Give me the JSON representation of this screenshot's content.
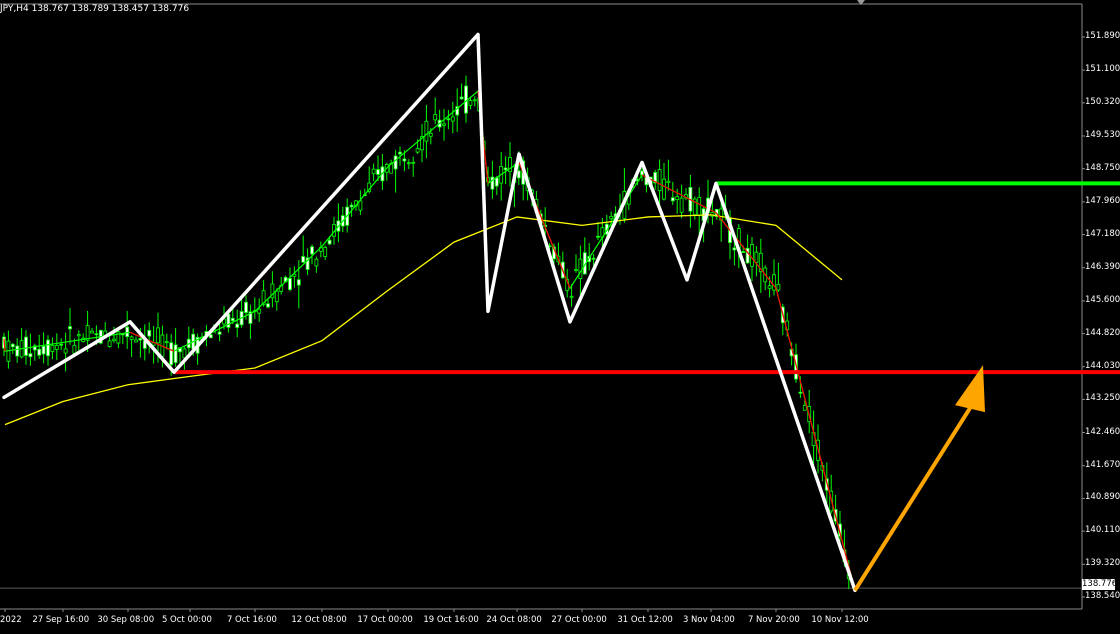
{
  "header": {
    "symbol_info": "JPY,H4 138.767 138.789 138.457 138.776"
  },
  "price_box": {
    "label": "138.776"
  },
  "colors": {
    "background": "#000000",
    "candles": "#00ff00",
    "fast_ma": "#00ff00",
    "fast_ma_down": "#ff0000",
    "slow_ma": "#ffff00",
    "zigzag": "#ffffff",
    "support_line": "#ff0000",
    "resistance_line": "#00ff00",
    "projection_arrow": "#ffa500"
  },
  "chart_data": {
    "type": "line",
    "title": "JPY,H4",
    "y_axis_ticks": [
      "151.890",
      "151.100",
      "150.320",
      "149.530",
      "148.750",
      "147.960",
      "147.180",
      "146.390",
      "145.600",
      "144.820",
      "144.030",
      "143.250",
      "142.460",
      "141.670",
      "140.890",
      "140.110",
      "139.320",
      "138.540"
    ],
    "x_axis_ticks": [
      "2022",
      "27 Sep 16:00",
      "30 Sep 08:00",
      "5 Oct 00:00",
      "7 Oct 16:00",
      "12 Oct 08:00",
      "17 Oct 00:00",
      "19 Oct 16:00",
      "24 Oct 08:00",
      "27 Oct 00:00",
      "31 Oct 12:00",
      "3 Nov 04:00",
      "7 Nov 20:00",
      "10 Nov 12:00"
    ],
    "ylim": [
      138.35,
      152.1
    ],
    "last_price": 138.776,
    "support_level": 143.9,
    "resistance_level": 148.4,
    "zigzag": [
      {
        "x": "27 Sep 16:00",
        "y": 143.3
      },
      {
        "x": "30 Sep 08:00",
        "y": 145.1
      },
      {
        "x": "5 Oct 00:00",
        "y": 143.9
      },
      {
        "x": "19 Oct 16:00",
        "y": 151.95
      },
      {
        "x": "24 Oct 00:00",
        "y": 145.35
      },
      {
        "x": "24 Oct 08:00",
        "y": 149.1
      },
      {
        "x": "27 Oct 00:00",
        "y": 145.1
      },
      {
        "x": "31 Oct 12:00",
        "y": 148.9
      },
      {
        "x": "3 Nov 00:00",
        "y": 146.1
      },
      {
        "x": "3 Nov 04:00",
        "y": 148.4
      },
      {
        "x": "10 Nov 12:00",
        "y": 138.7
      }
    ],
    "projection_arrow": {
      "from": {
        "x": "10 Nov 12:00",
        "y": 138.7
      },
      "to": {
        "y": 143.9
      }
    },
    "slow_ma": [
      {
        "x": "2022",
        "y": 142.65
      },
      {
        "x": "27 Sep 16:00",
        "y": 143.2
      },
      {
        "x": "30 Sep 08:00",
        "y": 143.6
      },
      {
        "x": "5 Oct 00:00",
        "y": 143.8
      },
      {
        "x": "7 Oct 16:00",
        "y": 144.0
      },
      {
        "x": "12 Oct 08:00",
        "y": 144.65
      },
      {
        "x": "17 Oct 00:00",
        "y": 145.85
      },
      {
        "x": "19 Oct 16:00",
        "y": 147.0
      },
      {
        "x": "24 Oct 08:00",
        "y": 147.6
      },
      {
        "x": "27 Oct 00:00",
        "y": 147.4
      },
      {
        "x": "31 Oct 12:00",
        "y": 147.6
      },
      {
        "x": "3 Nov 04:00",
        "y": 147.65
      },
      {
        "x": "7 Nov 20:00",
        "y": 147.4
      },
      {
        "x": "10 Nov 12:00",
        "y": 146.1
      }
    ],
    "fast_ma": [
      {
        "x": "2022",
        "y": 144.4
      },
      {
        "x": "27 Sep 16:00",
        "y": 144.7
      },
      {
        "x": "30 Sep 08:00",
        "y": 144.85
      },
      {
        "x": "5 Oct 00:00",
        "y": 144.4
      },
      {
        "x": "7 Oct 16:00",
        "y": 145.35
      },
      {
        "x": "12 Oct 08:00",
        "y": 146.9
      },
      {
        "x": "17 Oct 00:00",
        "y": 148.8
      },
      {
        "x": "19 Oct 16:00",
        "y": 150.6
      },
      {
        "x": "24 Oct 00:00",
        "y": 148.4
      },
      {
        "x": "24 Oct 08:00",
        "y": 148.9
      },
      {
        "x": "27 Oct 00:00",
        "y": 145.9
      },
      {
        "x": "31 Oct 12:00",
        "y": 148.6
      },
      {
        "x": "3 Nov 04:00",
        "y": 147.7
      },
      {
        "x": "7 Nov 20:00",
        "y": 145.9
      },
      {
        "x": "10 Nov 12:00",
        "y": 138.7
      }
    ]
  }
}
